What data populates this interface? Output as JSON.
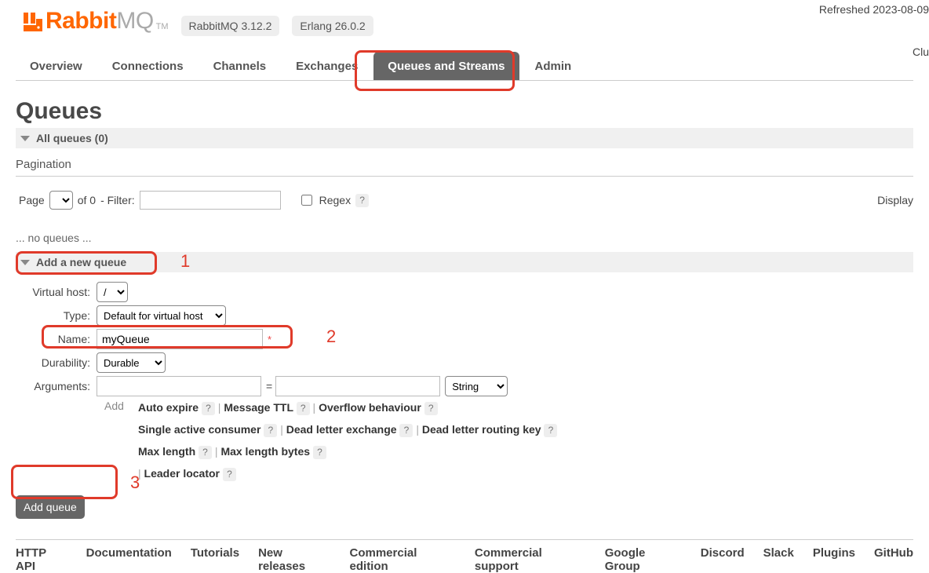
{
  "header": {
    "logo_part1": "Rabbit",
    "logo_part2": "MQ",
    "tm": "TM",
    "version_badge": "RabbitMQ 3.12.2",
    "erlang_badge": "Erlang 26.0.2",
    "refreshed": "Refreshed 2023-08-09 ",
    "cluster": "Clu"
  },
  "nav": {
    "overview": "Overview",
    "connections": "Connections",
    "channels": "Channels",
    "exchanges": "Exchanges",
    "queues_streams": "Queues and Streams",
    "admin": "Admin"
  },
  "page": {
    "title": "Queues",
    "all_queues": "All queues (0)",
    "pagination": "Pagination",
    "page_lbl": "Page",
    "of0": "of 0",
    "filter_lbl": "- Filter:",
    "regex": "Regex",
    "help_q": "?",
    "displaying": "Display",
    "no_queues": "... no queues ...",
    "add_new_queue": "Add a new queue"
  },
  "form": {
    "vhost_lbl": "Virtual host:",
    "vhost_val": "/",
    "type_lbl": "Type:",
    "type_val": "Default for virtual host",
    "name_lbl": "Name:",
    "name_val": "myQueue",
    "req": "*",
    "durability_lbl": "Durability:",
    "durability_val": "Durable",
    "args_lbl": "Arguments:",
    "args_eq": "=",
    "args_type": "String",
    "add_row": "Add",
    "opts": {
      "auto_expire": "Auto expire",
      "msg_ttl": "Message TTL",
      "overflow": "Overflow behaviour",
      "sac": "Single active consumer",
      "dlx": "Dead letter exchange",
      "dlrk": "Dead letter routing key",
      "maxlen": "Max length",
      "maxlenb": "Max length bytes",
      "leader": "Leader locator",
      "sep": "|"
    },
    "add_btn": "Add queue"
  },
  "footer": {
    "http_api": "HTTP API",
    "docs": "Documentation",
    "tutorials": "Tutorials",
    "releases": "New releases",
    "commercial_ed": "Commercial edition",
    "commercial_sup": "Commercial support",
    "google": "Google Group",
    "discord": "Discord",
    "slack": "Slack",
    "plugins": "Plugins",
    "github": "GitHub"
  },
  "annotations": {
    "a1": "1",
    "a2": "2",
    "a3": "3"
  }
}
